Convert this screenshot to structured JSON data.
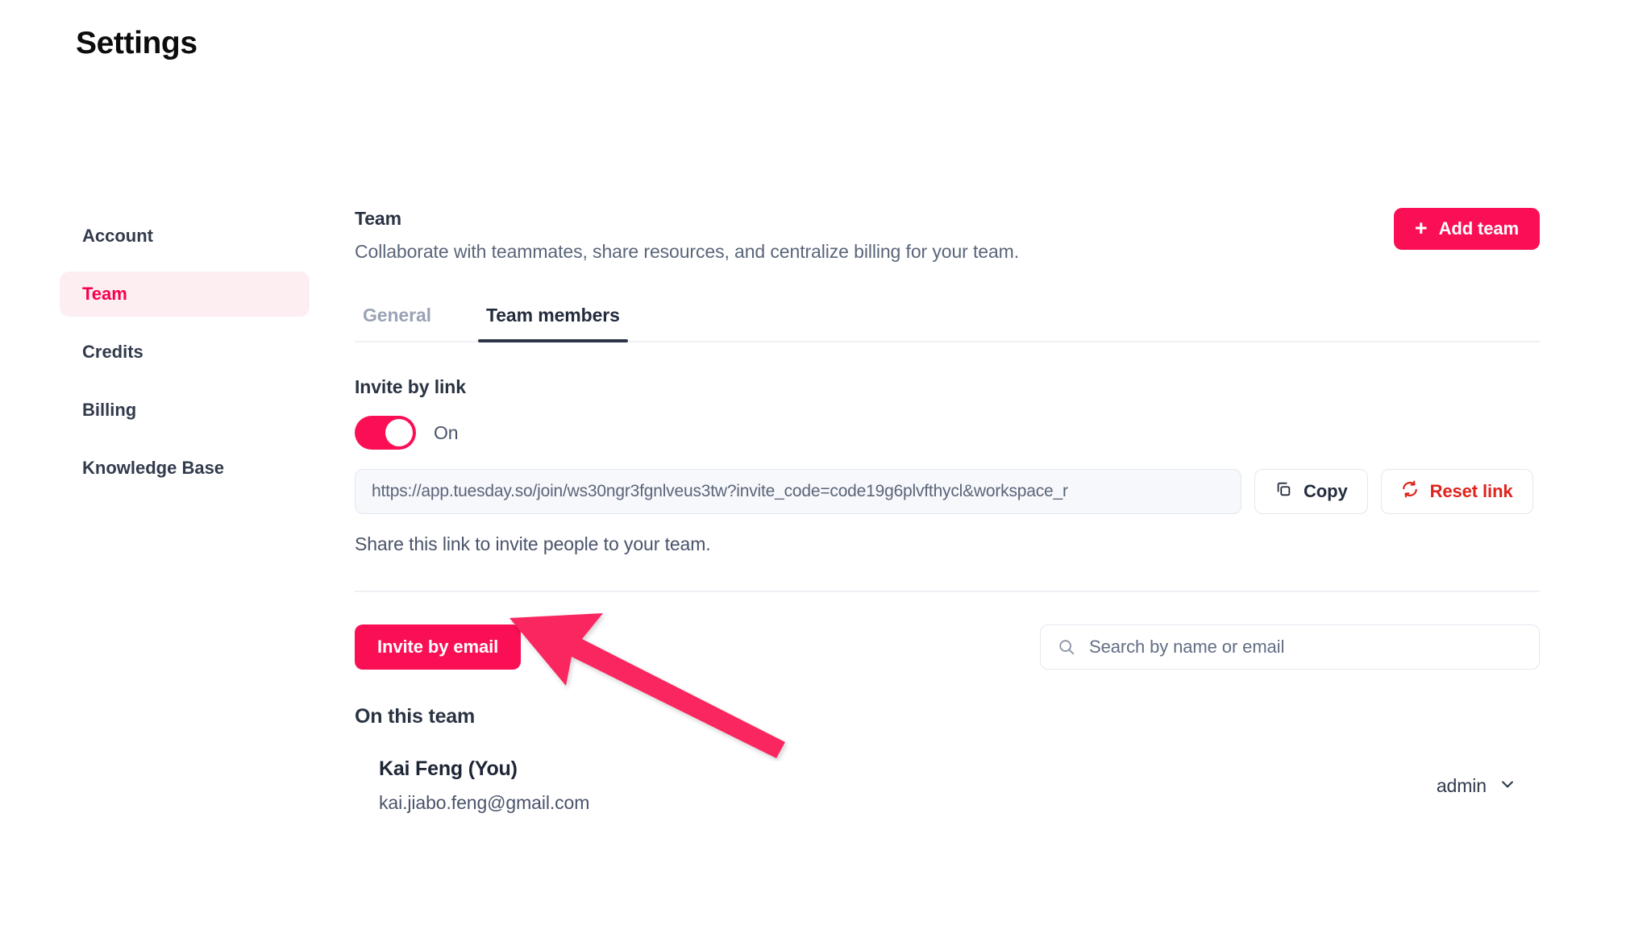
{
  "page_title": "Settings",
  "sidebar": {
    "items": [
      {
        "label": "Account",
        "active": false
      },
      {
        "label": "Team",
        "active": true
      },
      {
        "label": "Credits",
        "active": false
      },
      {
        "label": "Billing",
        "active": false
      },
      {
        "label": "Knowledge Base",
        "active": false
      }
    ]
  },
  "section": {
    "title": "Team",
    "subtitle": "Collaborate with teammates, share resources, and centralize billing for your team.",
    "add_team_label": "Add team",
    "add_team_icon": "plus-icon"
  },
  "tabs": [
    {
      "label": "General",
      "active": false
    },
    {
      "label": "Team members",
      "active": true
    }
  ],
  "invite_link": {
    "label": "Invite by link",
    "toggle_state": "On",
    "toggle_on": true,
    "url": "https://app.tuesday.so/join/ws30ngr3fgnlveus3tw?invite_code=code19g6plvfthycl&workspace_r",
    "copy_label": "Copy",
    "copy_icon": "copy-icon",
    "reset_label": "Reset link",
    "reset_icon": "refresh-icon",
    "hint": "Share this link to invite people to your team."
  },
  "members_toolbar": {
    "invite_by_email_label": "Invite by email",
    "search_placeholder": "Search by name or email",
    "search_value": "",
    "search_icon": "search-icon"
  },
  "members": {
    "list_title": "On this team",
    "rows": [
      {
        "name": "Kai Feng (You)",
        "email": "kai.jiabo.feng@gmail.com",
        "role": "admin",
        "role_icon": "chevron-down-icon"
      }
    ]
  },
  "annotation": {
    "type": "arrow",
    "points_to": "Invite by email",
    "color": "#f9275f"
  },
  "colors": {
    "accent_pink": "#fa0f55",
    "accent_pink_soft": "#fdeef2",
    "danger_red": "#e0231c",
    "text_dark": "#2a3342",
    "text_muted": "#5a6579",
    "border": "#e3e7ef"
  }
}
